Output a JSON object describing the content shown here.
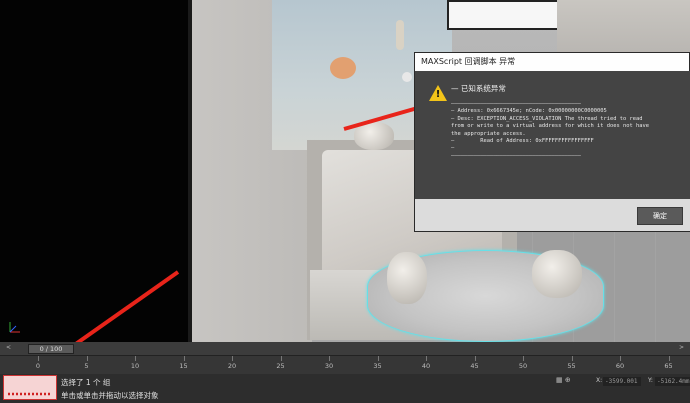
{
  "dialog": {
    "title": "MAXScript 回调脚本 异常",
    "heading": "— 已知系统异常",
    "details": "————————————————————————————————————————\n— Address: 0x6667345e; nCode: 0x00000000C0000005\n— Desc: EXCEPTION_ACCESS_VIOLATION The thread tried to read\nfrom or write to a virtual address for which it does not have\nthe appropriate access.\n—        Read of Address: 0xFFFFFFFFFFFFFFFF\n—\n————————————————————————————————————————",
    "ok_label": "确定"
  },
  "timeline": {
    "slider_value": "0 / 100",
    "slider_prev": "<",
    "slider_next": ">",
    "ticks": [
      "0",
      "5",
      "10",
      "15",
      "20",
      "25",
      "30",
      "35",
      "40",
      "45",
      "50",
      "55",
      "60",
      "65"
    ]
  },
  "status": {
    "line1": "选择了 1 个 组",
    "line2": "单击或单击并拖动以选择对象",
    "x_label": "X:",
    "x_value": "-3599.001",
    "y_label": "Y:",
    "y_value": "-5162.4mm"
  },
  "colors": {
    "warning": "#f3c419",
    "arrow": "#e8241a",
    "selection_outline": "#66e0e8"
  }
}
